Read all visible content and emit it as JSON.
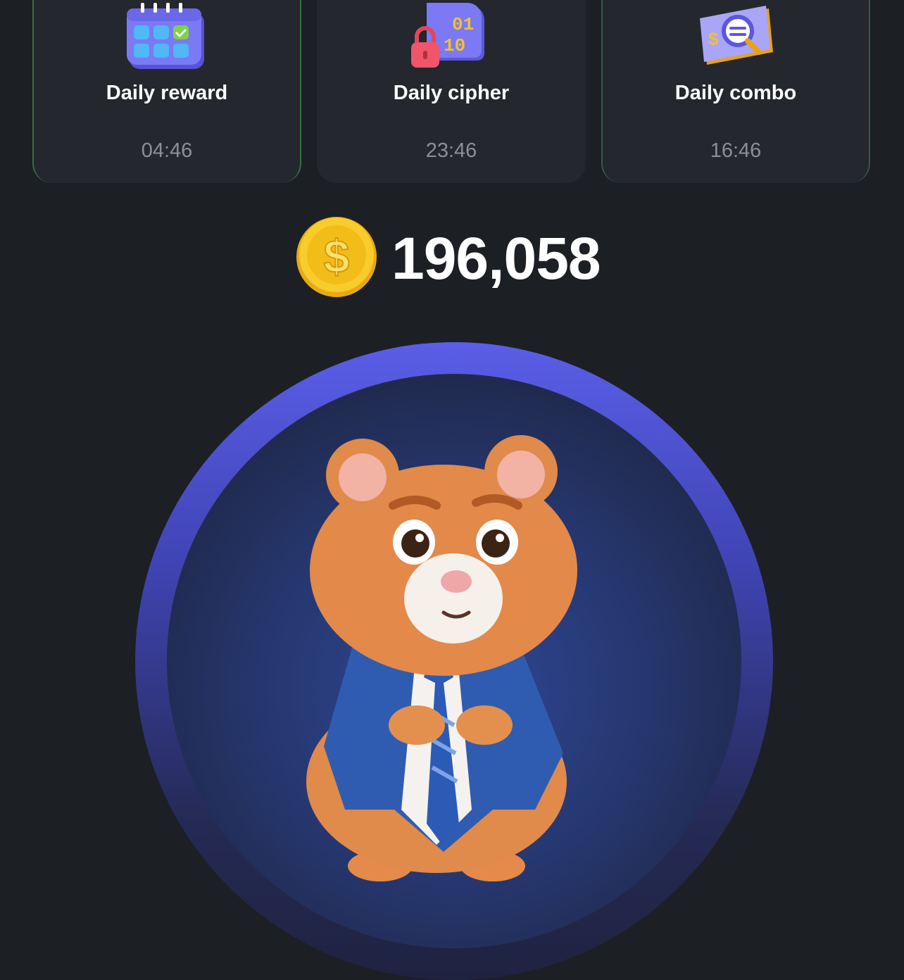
{
  "daily_cards": [
    {
      "title": "Daily reward",
      "timer": "04:46",
      "icon": "calendar-icon"
    },
    {
      "title": "Daily cipher",
      "timer": "23:46",
      "icon": "cipher-lock-icon"
    },
    {
      "title": "Daily combo",
      "timer": "16:46",
      "icon": "combo-search-icon"
    }
  ],
  "balance": {
    "value": "196,058",
    "icon": "coin-icon"
  },
  "tap_area": {
    "character": "hamster-ceo"
  },
  "colors": {
    "background": "#1c1f24",
    "card": "#24272d",
    "accent": "#5a5ee8",
    "coin": "#f6c521"
  }
}
